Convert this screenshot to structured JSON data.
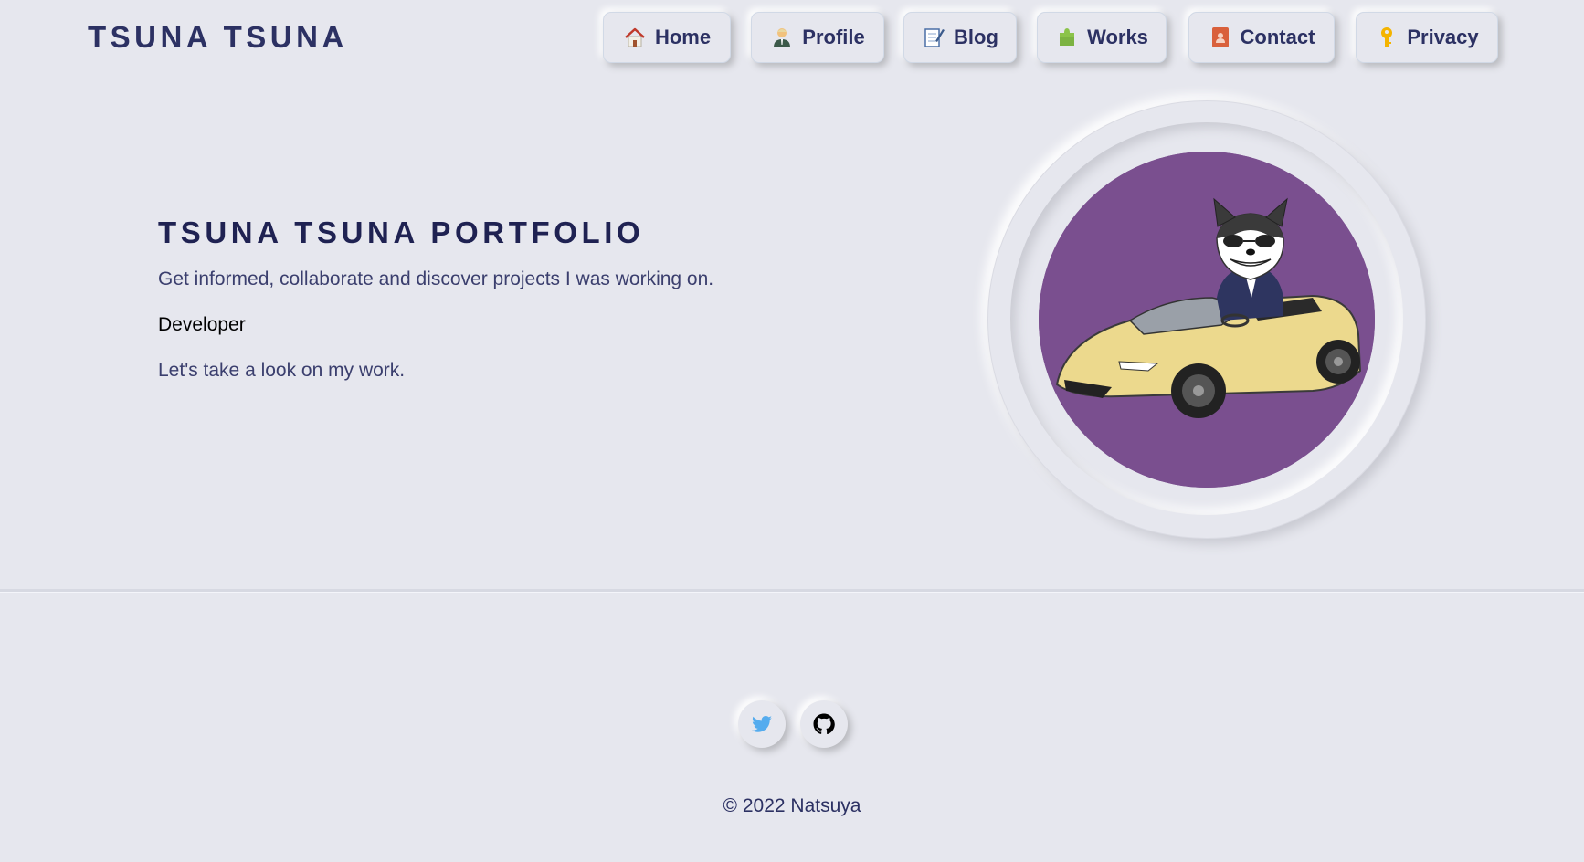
{
  "header": {
    "brand": "TSUNA TSUNA",
    "nav": [
      {
        "label": "Home",
        "icon": "house-icon"
      },
      {
        "label": "Profile",
        "icon": "person-icon"
      },
      {
        "label": "Blog",
        "icon": "memo-icon"
      },
      {
        "label": "Works",
        "icon": "puzzle-icon"
      },
      {
        "label": "Contact",
        "icon": "address-book-icon"
      },
      {
        "label": "Privacy",
        "icon": "key-icon"
      }
    ]
  },
  "hero": {
    "title": "TSUNA TSUNA PORTFOLIO",
    "subtitle": "Get informed, collaborate and discover projects I was working on.",
    "role": "Developer",
    "cta": "Let's take a look on my work.",
    "avatar_bg": "#7a4f8f"
  },
  "footer": {
    "social": [
      {
        "name": "twitter",
        "icon": "twitter-icon",
        "color": "#55acee"
      },
      {
        "name": "github",
        "icon": "github-icon",
        "color": "#000000"
      }
    ],
    "copyright": "© 2022 Natsuya"
  },
  "colors": {
    "background": "#e6e7ee",
    "text": "#2c3163"
  }
}
